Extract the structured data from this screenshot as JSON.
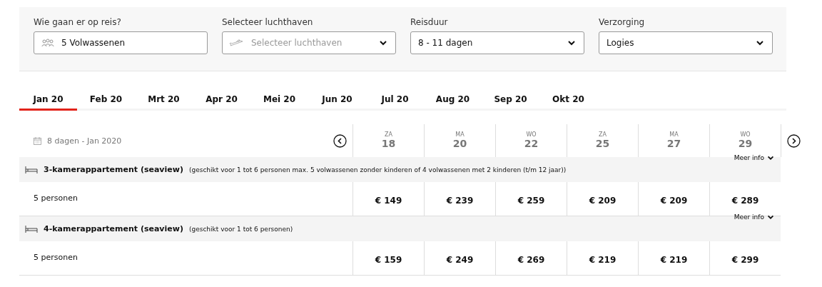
{
  "filters": [
    {
      "label": "Wie gaan er op reis?",
      "kind": "travelers",
      "value": "5 Volwassenen"
    },
    {
      "label": "Selecteer luchthaven",
      "kind": "airport",
      "placeholder": "Selecteer luchthaven"
    },
    {
      "label": "Reisduur",
      "kind": "select",
      "value": "8 - 11 dagen"
    },
    {
      "label": "Verzorging",
      "kind": "select",
      "value": "Logies"
    }
  ],
  "month_tabs": [
    {
      "label": "Jan 20",
      "selected": true
    },
    {
      "label": "Feb 20",
      "selected": false
    },
    {
      "label": "Mrt 20",
      "selected": false
    },
    {
      "label": "Apr 20",
      "selected": false
    },
    {
      "label": "Mei 20",
      "selected": false
    },
    {
      "label": "Jun 20",
      "selected": false
    },
    {
      "label": "Jul 20",
      "selected": false
    },
    {
      "label": "Aug 20",
      "selected": false
    },
    {
      "label": "Sep 20",
      "selected": false
    },
    {
      "label": "Okt 20",
      "selected": false
    }
  ],
  "period": "8 dagen - Jan 2020",
  "dates": [
    {
      "weekday": "ZA",
      "day": "18"
    },
    {
      "weekday": "MA",
      "day": "20"
    },
    {
      "weekday": "WO",
      "day": "22"
    },
    {
      "weekday": "ZA",
      "day": "25"
    },
    {
      "weekday": "MA",
      "day": "27"
    },
    {
      "weekday": "WO",
      "day": "29"
    }
  ],
  "rooms": [
    {
      "name": "3-kamerappartement (seaview)",
      "description": "(geschikt voor 1 tot 6 personen max. 5 volwassenen zonder kinderen of 4 volwassenen met 2 kinderen (t/m 12 jaar))",
      "more": "Meer info",
      "persons": "5 personen",
      "prices": [
        "€ 149",
        "€ 239",
        "€ 259",
        "€ 209",
        "€ 209",
        "€ 289"
      ]
    },
    {
      "name": "4-kamerappartement (seaview)",
      "description": "(geschikt voor 1 tot 6 personen)",
      "more": "Meer info",
      "persons": "5 personen",
      "prices": [
        "€ 159",
        "€ 249",
        "€ 269",
        "€ 219",
        "€ 219",
        "€ 299"
      ]
    }
  ]
}
